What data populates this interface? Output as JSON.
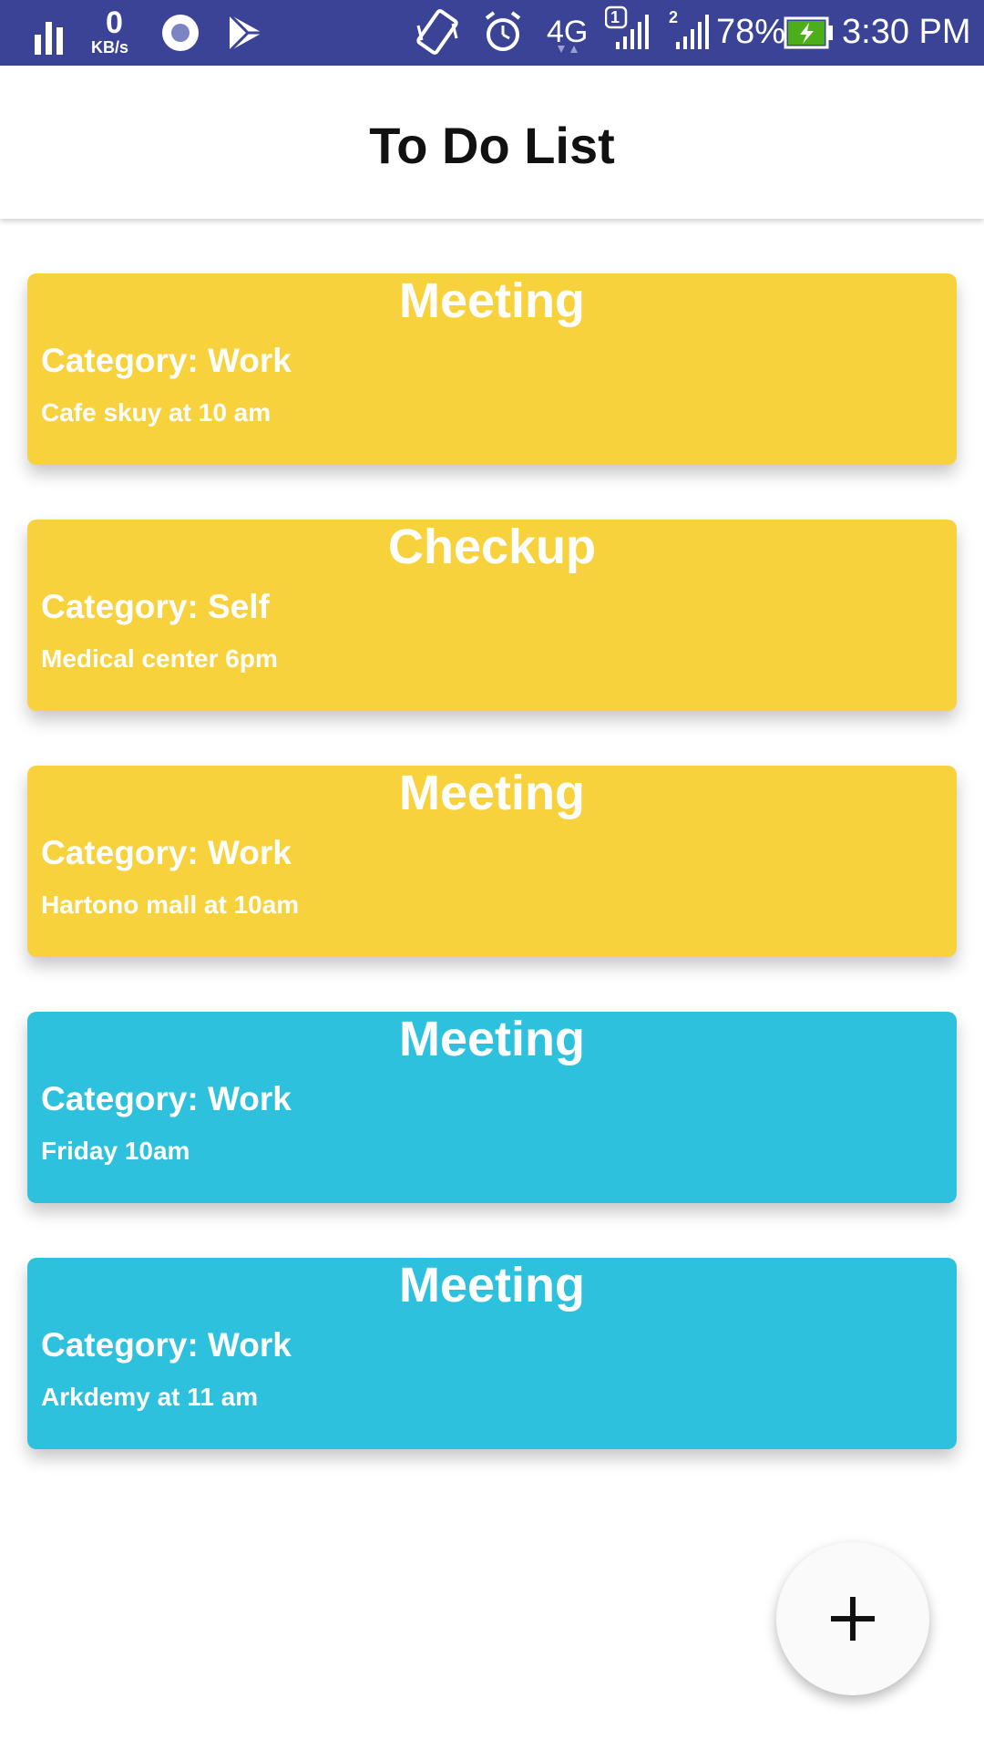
{
  "status_bar": {
    "network_speed_value": "0",
    "network_speed_unit": "KB/s",
    "network_type": "4G",
    "sim1_label": "1",
    "sim2_label": "2",
    "battery_percent": "78%",
    "time": "3:30 PM",
    "icons": [
      "signal-bars-icon",
      "network-speed-icon",
      "record-icon",
      "play-store-icon",
      "vibrate-icon",
      "alarm-icon",
      "4g-icon",
      "sim1-signal-icon",
      "sim2-signal-icon",
      "battery-charging-icon"
    ],
    "colors": {
      "background": "#3a4396",
      "battery_fill": "#4caf1a"
    }
  },
  "app_bar": {
    "title": "To Do List"
  },
  "tasks": [
    {
      "title": "Meeting",
      "category": "Category: Work",
      "detail": "Cafe skuy at 10 am",
      "color": "#f8d23c"
    },
    {
      "title": "Checkup",
      "category": "Category: Self",
      "detail": "Medical center 6pm",
      "color": "#f8d23c"
    },
    {
      "title": "Meeting",
      "category": "Category: Work",
      "detail": "Hartono mall at 10am",
      "color": "#f8d23c"
    },
    {
      "title": "Meeting",
      "category": "Category: Work",
      "detail": "Friday 10am",
      "color": "#2ec1de"
    },
    {
      "title": "Meeting",
      "category": "Category: Work",
      "detail": "Arkdemy at 11 am",
      "color": "#2ec1de"
    }
  ],
  "fab": {
    "icon": "plus-icon"
  }
}
